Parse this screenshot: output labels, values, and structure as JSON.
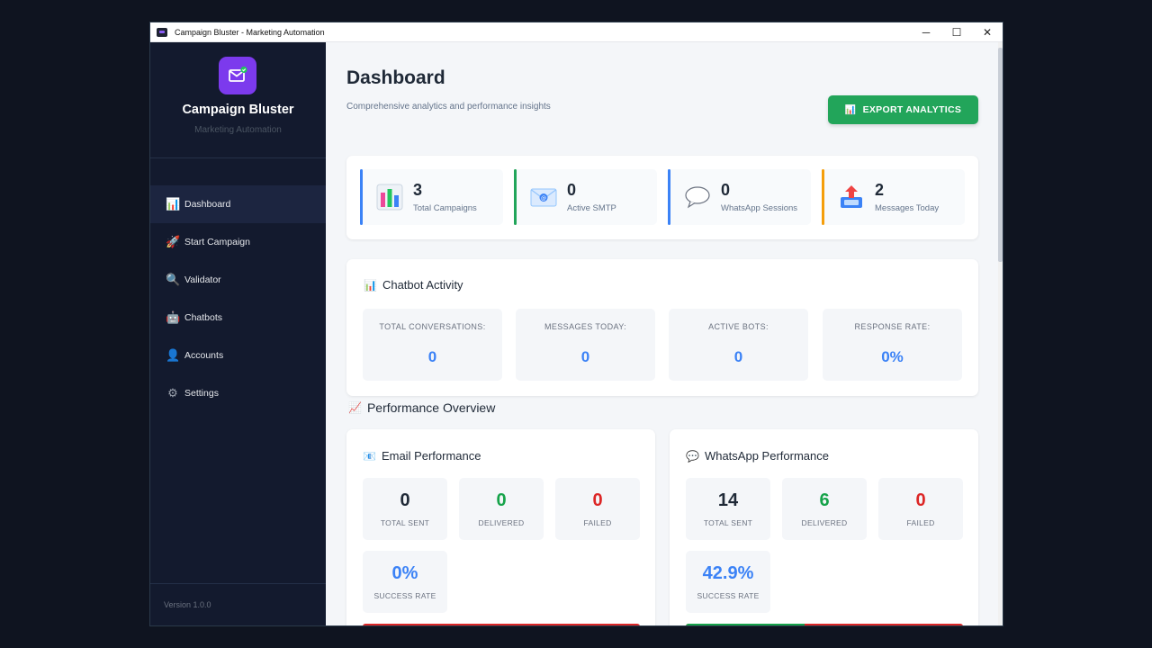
{
  "window": {
    "title": "Campaign Bluster - Marketing Automation",
    "minimize": "─",
    "maximize": "☐",
    "close": "✕"
  },
  "sidebar": {
    "brand": "Campaign Bluster",
    "subtitle": "Marketing Automation",
    "items": [
      {
        "label": "Dashboard",
        "icon": "bar-chart-icon",
        "glyph": "📊",
        "active": true
      },
      {
        "label": "Start Campaign",
        "icon": "rocket-icon",
        "glyph": "🚀"
      },
      {
        "label": "Validator",
        "icon": "magnifier-icon",
        "glyph": "🔍"
      },
      {
        "label": "Chatbots",
        "icon": "robot-icon",
        "glyph": "🤖"
      },
      {
        "label": "Accounts",
        "icon": "user-icon",
        "glyph": "👤"
      },
      {
        "label": "Settings",
        "icon": "gear-icon",
        "glyph": "⚙"
      }
    ],
    "version": "Version 1.0.0"
  },
  "header": {
    "title": "Dashboard",
    "subtitle": "Comprehensive analytics and performance insights",
    "export_label": "EXPORT ANALYTICS"
  },
  "stats": [
    {
      "value": "3",
      "label": "Total Campaigns",
      "icon": "bar-chart-icon",
      "accent": "#3b82f6"
    },
    {
      "value": "0",
      "label": "Active SMTP",
      "icon": "email-icon",
      "accent": "#22a55a"
    },
    {
      "value": "0",
      "label": "WhatsApp Sessions",
      "icon": "speech-bubble-icon",
      "accent": "#3b82f6"
    },
    {
      "value": "2",
      "label": "Messages Today",
      "icon": "outbox-icon",
      "accent": "#f59e0b"
    }
  ],
  "chatbot": {
    "title": "Chatbot Activity",
    "metrics": [
      {
        "label": "TOTAL CONVERSATIONS:",
        "value": "0"
      },
      {
        "label": "MESSAGES TODAY:",
        "value": "0"
      },
      {
        "label": "ACTIVE BOTS:",
        "value": "0"
      },
      {
        "label": "RESPONSE RATE:",
        "value": "0%"
      }
    ]
  },
  "performance": {
    "title": "Performance Overview",
    "email": {
      "title": "Email Performance",
      "total_sent": "0",
      "total_sent_label": "TOTAL SENT",
      "delivered": "0",
      "delivered_label": "DELIVERED",
      "failed": "0",
      "failed_label": "FAILED",
      "success_rate": "0%",
      "success_rate_label": "SUCCESS RATE",
      "success_fraction": 0
    },
    "whatsapp": {
      "title": "WhatsApp Performance",
      "total_sent": "14",
      "total_sent_label": "TOTAL SENT",
      "delivered": "6",
      "delivered_label": "DELIVERED",
      "failed": "0",
      "failed_label": "FAILED",
      "success_rate": "42.9%",
      "success_rate_label": "SUCCESS RATE",
      "success_fraction": 0.429
    }
  },
  "colors": {
    "accent_green": "#22a55a",
    "accent_blue": "#3b82f6",
    "fail_red": "#dc2626",
    "sidebar_bg": "#131a2e"
  }
}
